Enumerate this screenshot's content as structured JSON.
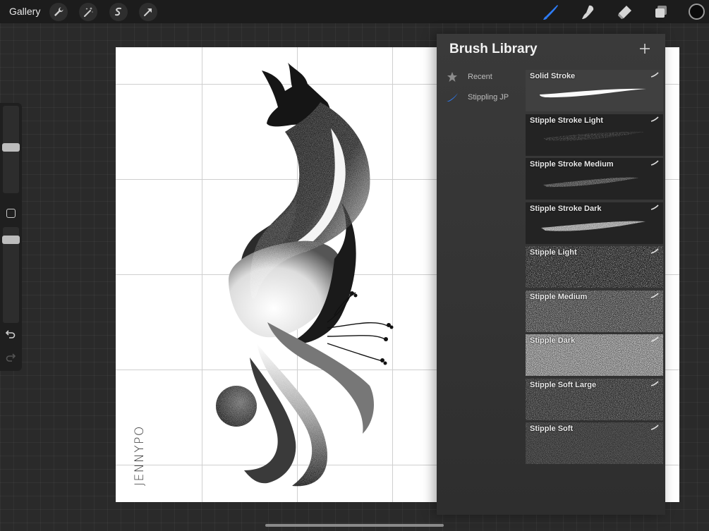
{
  "topbar": {
    "gallery_label": "Gallery",
    "left_tools": [
      "actions-icon",
      "adjustments-icon",
      "selection-icon",
      "transform-icon"
    ],
    "right_tools": [
      "brush-icon",
      "smudge-icon",
      "eraser-icon",
      "layers-icon"
    ],
    "active_tool": "brush",
    "accent_color": "#2e7cf6",
    "current_color": "#0a0a0a"
  },
  "sidebar": {
    "brush_size_level": 0.5,
    "opacity_level": 0.5,
    "controls": [
      "brush-size-slider",
      "modify-button",
      "opacity-slider",
      "undo-button",
      "redo-button"
    ]
  },
  "canvas": {
    "signature_text": "JENNYPO",
    "grid_visible": true
  },
  "brush_library": {
    "title": "Brush Library",
    "sets": [
      {
        "label": "Recent",
        "icon": "star-icon"
      },
      {
        "label": "Stippling JP",
        "icon": "brush-set-icon",
        "selected": true
      }
    ],
    "brushes": [
      {
        "name": "Solid Stroke",
        "preview": "solid"
      },
      {
        "name": "Stipple Stroke Light",
        "preview": "stroke-light"
      },
      {
        "name": "Stipple Stroke Medium",
        "preview": "stroke-medium"
      },
      {
        "name": "Stipple Stroke Dark",
        "preview": "stroke-dark"
      },
      {
        "name": "Stipple Light",
        "preview": "fill-light"
      },
      {
        "name": "Stipple Medium",
        "preview": "fill-medium"
      },
      {
        "name": "Stipple Dark",
        "preview": "fill-dark"
      },
      {
        "name": "Stipple Soft Large",
        "preview": "soft-large"
      },
      {
        "name": "Stipple Soft",
        "preview": "soft"
      }
    ]
  }
}
